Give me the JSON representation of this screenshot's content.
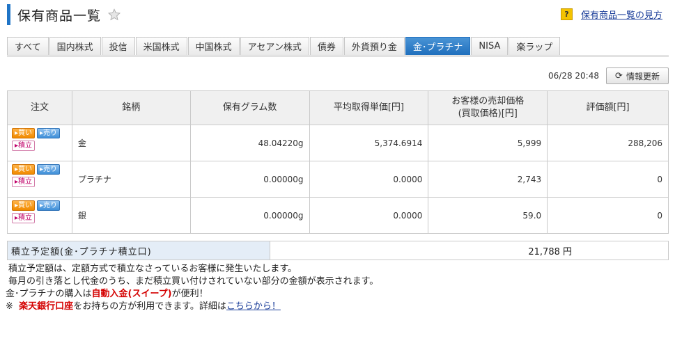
{
  "header": {
    "title": "保有商品一覧",
    "help_icon": "?",
    "help_link": "保有商品一覧の見方"
  },
  "tabs": [
    {
      "label": "すべて",
      "active": false
    },
    {
      "label": "国内株式",
      "active": false
    },
    {
      "label": "投信",
      "active": false
    },
    {
      "label": "米国株式",
      "active": false
    },
    {
      "label": "中国株式",
      "active": false
    },
    {
      "label": "アセアン株式",
      "active": false
    },
    {
      "label": "債券",
      "active": false
    },
    {
      "label": "外貨預り金",
      "active": false
    },
    {
      "label": "金･プラチナ",
      "active": true
    },
    {
      "label": "NISA",
      "active": false
    },
    {
      "label": "楽ラップ",
      "active": false
    }
  ],
  "update": {
    "time": "06/28 20:48",
    "button_label": "情報更新"
  },
  "table": {
    "headers": {
      "order": "注文",
      "name": "銘柄",
      "grams": "保有グラム数",
      "avg_cost": "平均取得単価[円]",
      "sell_price_1": "お客様の売却価格",
      "sell_price_2": "(買取価格)[円]",
      "valuation": "評価額[円]"
    },
    "order_buttons": {
      "buy": "▸買い",
      "sell": "▸売り",
      "accumulate": "▸積立"
    },
    "rows": [
      {
        "name": "金",
        "grams": "48.04220g",
        "avg_cost": "5,374.6914",
        "sell_price": "5,999",
        "valuation": "288,206"
      },
      {
        "name": "プラチナ",
        "grams": "0.00000g",
        "avg_cost": "0.0000",
        "sell_price": "2,743",
        "valuation": "0"
      },
      {
        "name": "銀",
        "grams": "0.00000g",
        "avg_cost": "0.0000",
        "sell_price": "59.0",
        "valuation": "0"
      }
    ]
  },
  "plan": {
    "label": "積立予定額(金･プラチナ積立口)",
    "value": "21,788 円"
  },
  "notes": {
    "line1": "積立予定額は、定額方式で積立なさっているお客様に発生いたします。",
    "line2": "毎月の引き落とし代金のうち、まだ積立買い付けされていない部分の金額が表示されます。",
    "line3_pre": "金･プラチナの購入は",
    "line3_red": "自動入金(スイープ)",
    "line3_post": "が便利！",
    "line4_mark": "※",
    "line4_red": "楽天銀行口座",
    "line4_mid": "をお持ちの方が利用できます。詳細は",
    "line4_link": "こちらから！"
  }
}
